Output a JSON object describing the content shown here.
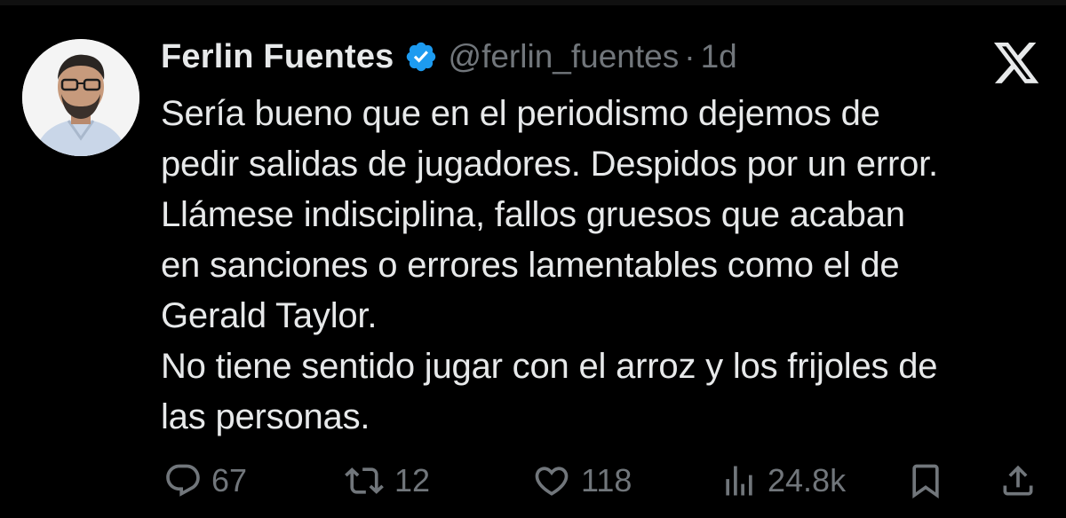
{
  "tweet": {
    "author": {
      "display_name": "Ferlin Fuentes",
      "handle": "@ferlin_fuentes",
      "verified": true,
      "avatar_icon": "profile-photo"
    },
    "separator": "·",
    "time": "1d",
    "platform_icon": "x-logo-icon",
    "text": "Sería bueno que en el periodismo dejemos de\npedir salidas de jugadores. Despidos por un error.\nLlámese indisciplina, fallos gruesos que acaban\nen sanciones o errores lamentables como el de\nGerald Taylor.\nNo tiene sentido jugar con el arroz y los frijoles de\nlas personas."
  },
  "actions": {
    "reply": {
      "icon": "reply-icon",
      "count": "67"
    },
    "retweet": {
      "icon": "retweet-icon",
      "count": "12"
    },
    "like": {
      "icon": "heart-icon",
      "count": "118"
    },
    "views": {
      "icon": "views-icon",
      "count": "24.8k"
    },
    "bookmark": {
      "icon": "bookmark-icon"
    },
    "share": {
      "icon": "share-icon"
    }
  },
  "colors": {
    "background": "#000000",
    "text": "#e7e9ea",
    "muted": "#71767b",
    "verified_badge": "#1d9bf0"
  }
}
